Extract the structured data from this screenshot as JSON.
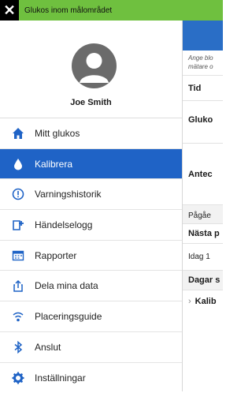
{
  "banner": {
    "close_icon": "close-icon",
    "text": "Glukos inom målområdet",
    "color": "#6fc03f"
  },
  "profile": {
    "name": "Joe Smith"
  },
  "menu": [
    {
      "label": "Mitt glukos",
      "icon": "home-icon",
      "active": false
    },
    {
      "label": "Kalibrera",
      "icon": "drop-icon",
      "active": true
    },
    {
      "label": "Varningshistorik",
      "icon": "alert-icon",
      "active": false
    },
    {
      "label": "Händelselogg",
      "icon": "event-log-icon",
      "active": false
    },
    {
      "label": "Rapporter",
      "icon": "reports-icon",
      "active": false
    },
    {
      "label": "Dela mina data",
      "icon": "share-icon",
      "active": false
    },
    {
      "label": "Placeringsguide",
      "icon": "signal-icon",
      "active": false
    },
    {
      "label": "Anslut",
      "icon": "bluetooth-icon",
      "active": false
    },
    {
      "label": "Inställningar",
      "icon": "gear-icon",
      "active": false
    }
  ],
  "background_screen": {
    "hint": "Ange blo mätare o",
    "rows": [
      "Tid",
      "Gluko",
      "Antec",
      "Pågåe",
      "Nästa p",
      "Idag 1",
      "Dagar s",
      "Kalib"
    ]
  },
  "colors": {
    "accent": "#1f63c6",
    "menu_icon": "#1f63c6"
  }
}
